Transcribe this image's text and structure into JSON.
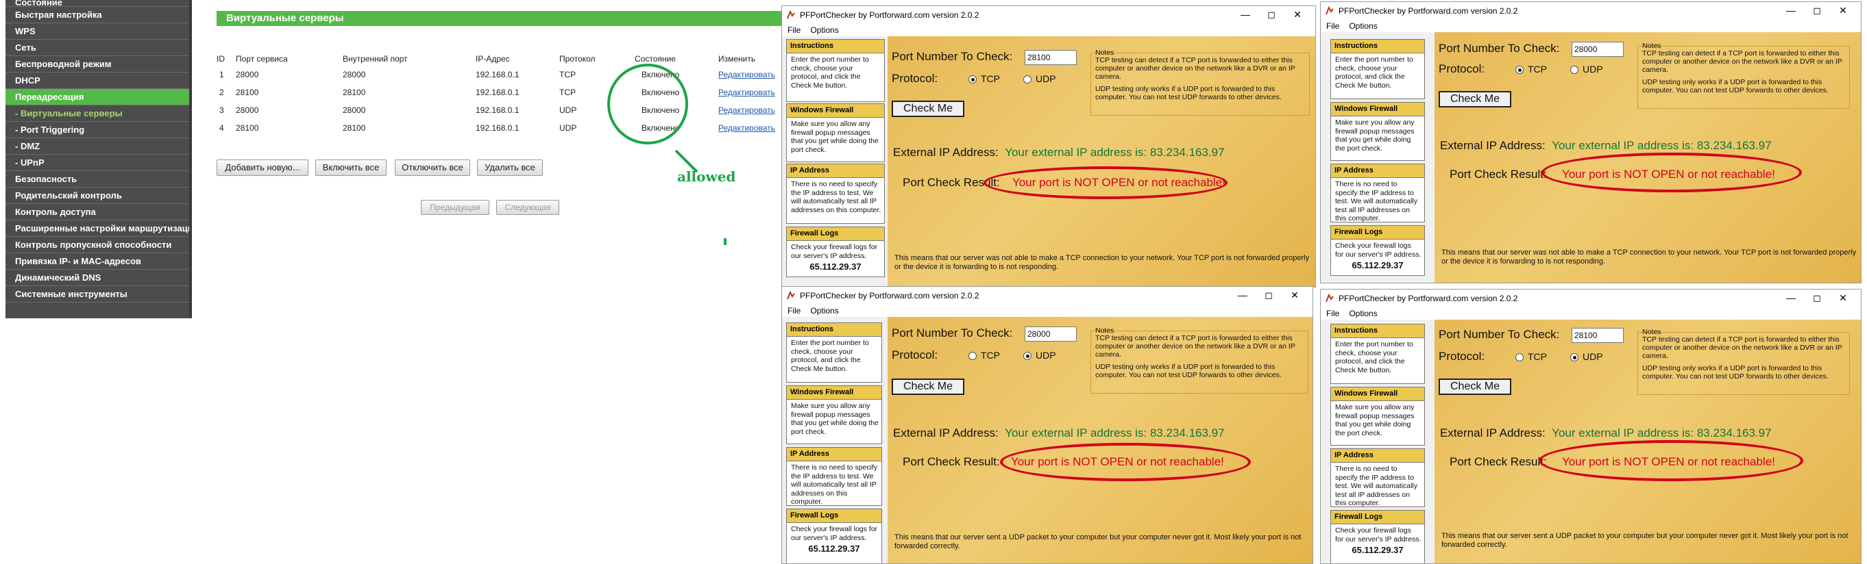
{
  "router": {
    "sidebar": [
      "Состояние",
      "Быстрая настройка",
      "WPS",
      "Сеть",
      "Беспроводной режим",
      "DHCP",
      "Переадресация",
      "- Виртуальные серверы",
      "- Port Triggering",
      "- DMZ",
      "- UPnP",
      "Безопасность",
      "Родительский контроль",
      "Контроль доступа",
      "Расширенные настройки маршрутизации",
      "Контроль пропускной способности",
      "Привязка IP- и MAC-адресов",
      "Динамический DNS",
      "Системные инструменты"
    ],
    "title": "Виртуальные серверы",
    "headers": [
      "ID",
      "Порт сервиса",
      "Внутренний порт",
      "IP-Адрес",
      "Протокол",
      "Состояние",
      "Изменить"
    ],
    "rows": [
      [
        "1",
        "28000",
        "28000",
        "192.168.0.1",
        "TCP",
        "Включено",
        "Редактировать"
      ],
      [
        "2",
        "28100",
        "28100",
        "192.168.0.1",
        "TCP",
        "Включено",
        "Редактировать"
      ],
      [
        "3",
        "28000",
        "28000",
        "192.168.0.1",
        "UDP",
        "Включено",
        "Редактировать"
      ],
      [
        "4",
        "28100",
        "28100",
        "192.168.0.1",
        "UDP",
        "Включено",
        "Редактировать"
      ]
    ],
    "buttons": {
      "add": "Добавить новую...",
      "enable_all": "Включить все",
      "disable_all": "Отключить все",
      "delete_all": "Удалить все",
      "prev": "Предыдущая",
      "next": "Следующая"
    },
    "annotation": "allowed",
    "colors": {
      "accent": "#54b948",
      "sidebar": "#4c4c4c",
      "annotation": "#1fa44a"
    }
  },
  "pf": {
    "title": "PFPortChecker by Portforward.com version 2.0.2",
    "menu": {
      "file": "File",
      "options": "Options"
    },
    "side": {
      "instructions_head": "Instructions",
      "instructions_text": "Enter the port number to check, choose your protocol, and click the Check Me button.",
      "firewall_head": "Windows Firewall",
      "firewall_text": "Make sure you allow any firewall popup messages that you get while doing the port check.",
      "ip_head": "IP Address",
      "ip_text": "There is no need to specify the IP address to test. We will automatically test all IP addresses on this computer.",
      "logs_head": "Firewall Logs",
      "logs_text": "Check your firewall logs for our server's IP address.",
      "server_ip": "65.112.29.37"
    },
    "port_label": "Port Number To Check:",
    "protocol_label": "Protocol:",
    "tcp": "TCP",
    "udp": "UDP",
    "check_button": "Check Me",
    "notes_title": "Notes",
    "notes_tcp": "TCP testing can detect if a TCP port is forwarded to either this computer or another device on the network like a DVR or an IP camera.",
    "notes_udp": "UDP testing only works if a UDP port is forwarded to this computer. You can not test UDP forwards to other devices.",
    "ext_label": "External IP Address:",
    "ext_value": "Your external IP address is: 83.234.163.97",
    "result_label": "Port Check Result:",
    "result_value": "Your port is NOT OPEN or not reachable!",
    "msg_tcp": "This means that our server was not able to make a TCP connection to your network. Your TCP port is not forwarded properly or the device it is forwarding to is not responding.",
    "msg_udp": "This means that our server sent a UDP packet to your computer but your computer never got it. Most likely your port is not forwarded correctly.",
    "windows": [
      {
        "port": "28100",
        "protocol": "TCP"
      },
      {
        "port": "28000",
        "protocol": "TCP"
      },
      {
        "port": "28000",
        "protocol": "UDP"
      },
      {
        "port": "28100",
        "protocol": "UDP"
      }
    ],
    "colors": {
      "panel": "#e6b956",
      "header": "#ecc84e",
      "result": "#d0021b",
      "ext_ip": "#11763a"
    }
  }
}
